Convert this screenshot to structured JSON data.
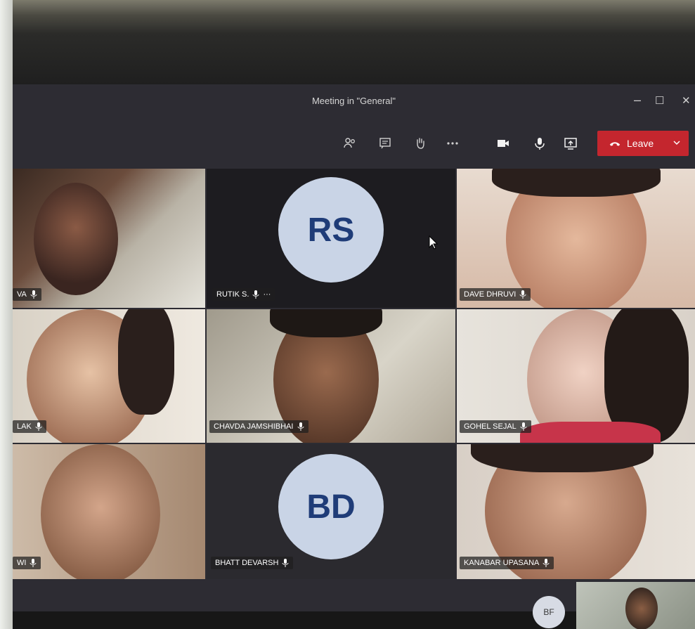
{
  "window": {
    "title": "Meeting in \"General\""
  },
  "toolbar": {
    "icons": [
      "participants-icon",
      "chat-icon",
      "raise-hand-icon",
      "more-options-icon",
      "camera-icon",
      "microphone-icon",
      "share-screen-icon"
    ],
    "leave_label": "Leave"
  },
  "participants": [
    {
      "name": "VA",
      "type": "video"
    },
    {
      "name": "RUTIK S.",
      "type": "avatar",
      "initials": "RS"
    },
    {
      "name": "DAVE DHRUVI",
      "type": "video"
    },
    {
      "name": "LAK",
      "type": "video"
    },
    {
      "name": "CHAVDA JAMSHIBHAI",
      "type": "video"
    },
    {
      "name": "GOHEL SEJAL",
      "type": "video"
    },
    {
      "name": "WI",
      "type": "video"
    },
    {
      "name": "BHATT DEVARSH",
      "type": "avatar",
      "initials": "BD"
    },
    {
      "name": "KANABAR UPASANA",
      "type": "video"
    }
  ],
  "overflow": {
    "initials": "BF"
  },
  "colors": {
    "leave": "#c4262e",
    "avatar_bg": "#c9d4e6",
    "avatar_text": "#1f3c78",
    "window_bg": "#2d2c33"
  }
}
